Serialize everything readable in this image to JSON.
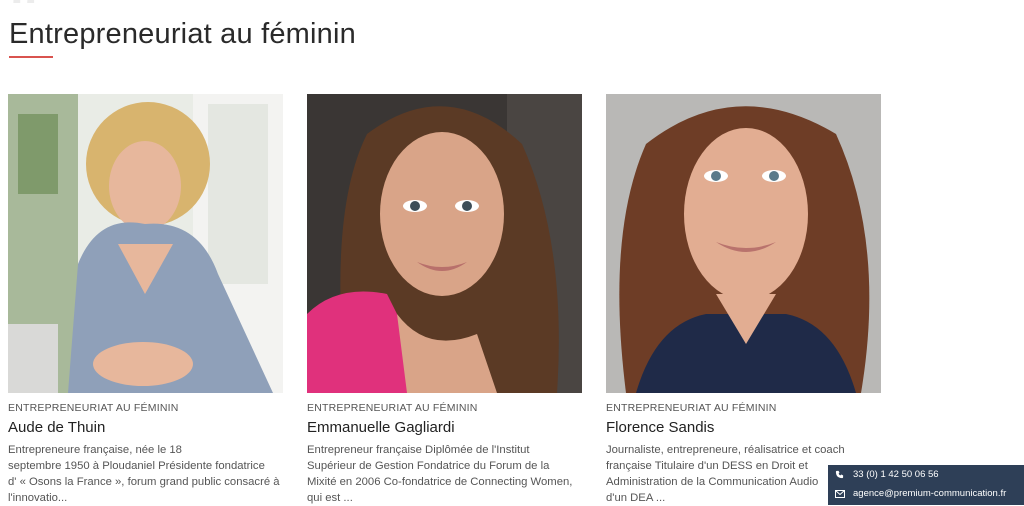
{
  "page": {
    "title": "Entrepreneuriat au féminin"
  },
  "cards": [
    {
      "category": "ENTREPRENEURIAT AU FÉMININ",
      "name": "Aude de Thuin",
      "excerpt_lines": [
        "Entrepreneure française, née le 18",
        "septembre 1950 à Ploudaniel Présidente fondatrice",
        "d' « Osons la France », forum grand public consacré à",
        "l'innovatio..."
      ]
    },
    {
      "category": "ENTREPRENEURIAT AU FÉMININ",
      "name": "Emmanuelle Gagliardi",
      "excerpt_lines": [
        "Entrepreneur française Diplômée de l'Institut",
        "Supérieur de Gestion Fondatrice du Forum de la",
        "Mixité en 2006 Co-fondatrice de Connecting Women,",
        "qui est ..."
      ]
    },
    {
      "category": "ENTREPRENEURIAT AU FÉMININ",
      "name": "Florence Sandis",
      "excerpt_lines": [
        "Journaliste, entrepreneure, réalisatrice et coach",
        "française Titulaire d'un DESS en Droit et",
        "Administration de la Communication Audio",
        "d'un DEA ..."
      ]
    }
  ],
  "contact": {
    "phone": "33 (0) 1 42 50 06 56",
    "email": "agence@premium-communication.fr"
  },
  "colors": {
    "accent": "#d9534f",
    "contact_bg": "#2e3f57"
  }
}
